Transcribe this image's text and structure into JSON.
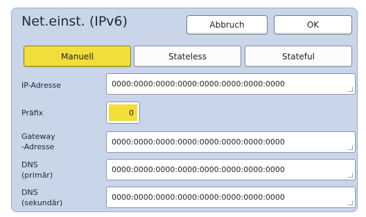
{
  "dialog": {
    "title": "Net.einst. (IPv6)",
    "cancel_label": "Abbruch",
    "ok_label": "OK"
  },
  "modes": {
    "items": [
      {
        "label": "Manuell",
        "active": true
      },
      {
        "label": "Stateless",
        "active": false
      },
      {
        "label": "Stateful",
        "active": false
      }
    ]
  },
  "fields": {
    "ip": {
      "label": "IP-Adresse",
      "value": "0000:0000:0000:0000:0000:0000:0000:0000"
    },
    "prefix": {
      "label": "Präfix",
      "value": "0"
    },
    "gateway": {
      "label_line1": "Gateway",
      "label_line2": "-Adresse",
      "value": "0000:0000:0000:0000:0000:0000:0000:0000"
    },
    "dns_primary": {
      "label_line1": "DNS",
      "label_line2": "(primär)",
      "value": "0000:0000:0000:0000:0000:0000:0000:0000"
    },
    "dns_secondary": {
      "label_line1": "DNS",
      "label_line2": "(sekundär)",
      "value": "0000:0000:0000:0000:0000:0000:0000:0000"
    }
  },
  "colors": {
    "panel_bg": "#c9d5e8",
    "active_yellow": "#f1de3b"
  }
}
